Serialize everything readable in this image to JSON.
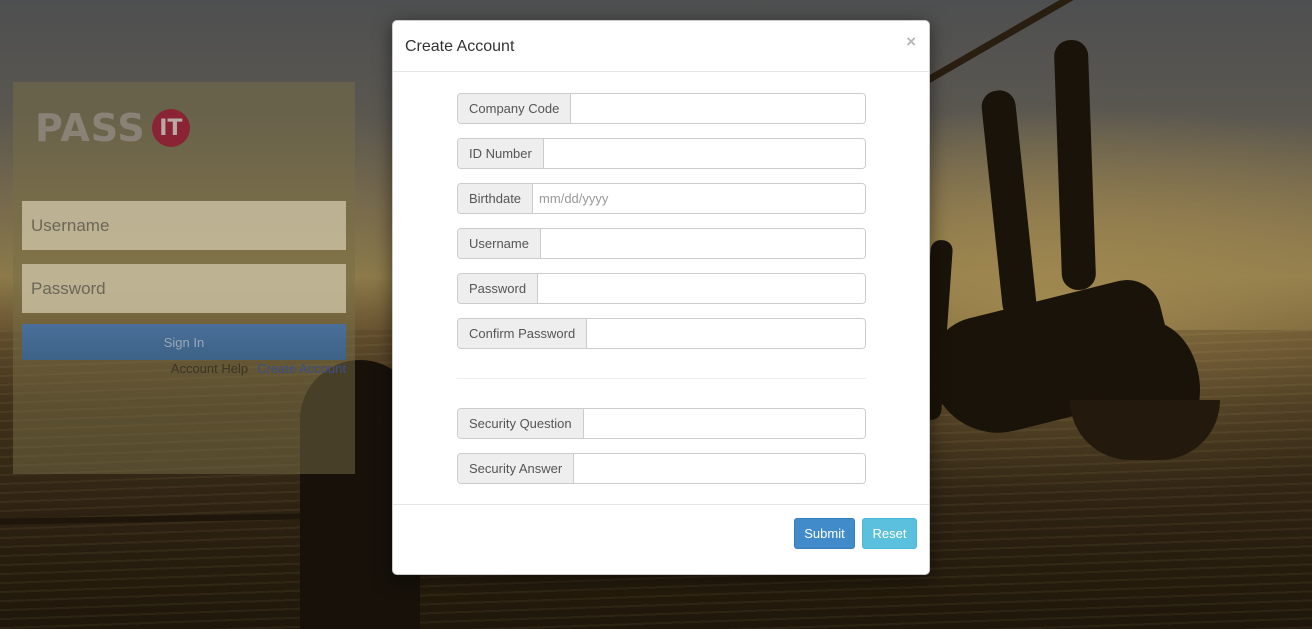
{
  "login": {
    "logo_text": "PASS",
    "logo_badge": "IT",
    "username_placeholder": "Username",
    "password_placeholder": "Password",
    "signin_label": "Sign In",
    "account_help_label": "Account Help",
    "create_account_label": "Create Account"
  },
  "modal": {
    "title": "Create Account",
    "close_symbol": "×",
    "fields": {
      "company_code": {
        "label": "Company Code",
        "value": "",
        "placeholder": ""
      },
      "id_number": {
        "label": "ID Number",
        "value": "",
        "placeholder": ""
      },
      "birthdate": {
        "label": "Birthdate",
        "value": "",
        "placeholder": "mm/dd/yyyy"
      },
      "username": {
        "label": "Username",
        "value": "",
        "placeholder": ""
      },
      "password": {
        "label": "Password",
        "value": "",
        "placeholder": ""
      },
      "confirm_password": {
        "label": "Confirm Password",
        "value": "",
        "placeholder": ""
      },
      "security_question": {
        "label": "Security Question",
        "value": "",
        "placeholder": ""
      },
      "security_answer": {
        "label": "Security Answer",
        "value": "",
        "placeholder": ""
      }
    },
    "submit_label": "Submit",
    "reset_label": "Reset"
  },
  "colors": {
    "primary": "#428bca",
    "info": "#5bc0de",
    "logo_accent": "#8a2434"
  }
}
